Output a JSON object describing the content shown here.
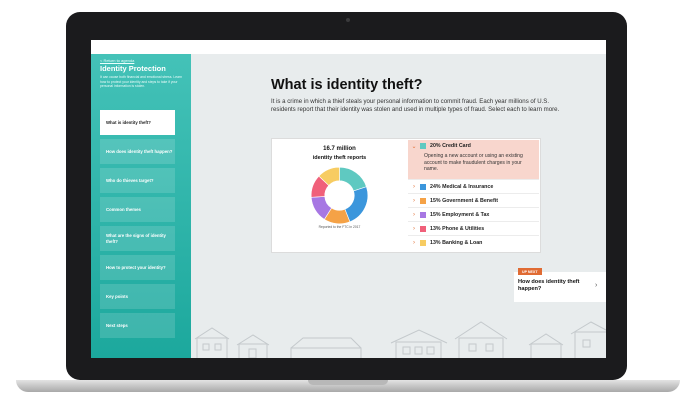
{
  "page": {
    "sidebar": {
      "back_link": "< Return to agenda",
      "title": "Identity Protection",
      "description": "It can cause both financial and emotional stress. Learn how to protect your identity and steps to take if your personal information is stolen.",
      "items": [
        {
          "label": "What is identity theft?",
          "active": true
        },
        {
          "label": "How does identity theft happen?",
          "active": false
        },
        {
          "label": "Who do thieves target?",
          "active": false
        },
        {
          "label": "Common themes",
          "active": false
        },
        {
          "label": "What are the signs of identity theft?",
          "active": false
        },
        {
          "label": "How to protect your identity?",
          "active": false
        },
        {
          "label": "Key points",
          "active": false
        },
        {
          "label": "Next steps",
          "active": false
        }
      ]
    },
    "main": {
      "title": "What is identity theft?",
      "intro": "It is a crime in which a thief steals your personal information to commit fraud. Each year millions of U.S. residents report that their identity was stolen and used in multiple types of fraud. Select each to learn more."
    },
    "stats": {
      "number": "16.7 million",
      "label": "identity theft reports",
      "source": "Reported to the FTC in 2017"
    },
    "categories": [
      {
        "label": "20% Credit Card",
        "value": 20,
        "color": "#5fc9c1",
        "expanded": true,
        "description": "Opening a new account or using an existing account to make fraudulent charges in your name."
      },
      {
        "label": "24% Medical & Insurance",
        "value": 24,
        "color": "#3b96dc",
        "expanded": false
      },
      {
        "label": "15% Government & Benefit",
        "value": 15,
        "color": "#f5a246",
        "expanded": false
      },
      {
        "label": "15% Employment & Tax",
        "value": 15,
        "color": "#a777e3",
        "expanded": false
      },
      {
        "label": "13% Phone & Utilities",
        "value": 13,
        "color": "#f0607a",
        "expanded": false
      },
      {
        "label": "13% Banking & Loan",
        "value": 13,
        "color": "#f7cc62",
        "expanded": false
      }
    ],
    "up_next": {
      "badge": "UP NEXT",
      "title": "How does identity theft happen?"
    }
  }
}
